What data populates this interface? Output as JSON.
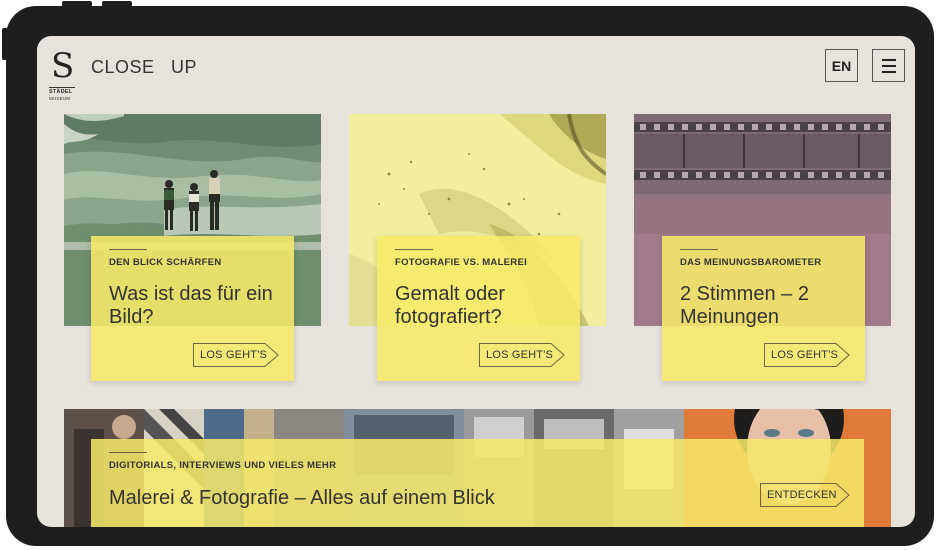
{
  "header": {
    "logo_mark": "S",
    "logo_line1": "STÄDEL",
    "logo_line2": "MUSEUM",
    "site_title": "CLOSE   UP",
    "lang_button": "EN"
  },
  "cards": [
    {
      "kicker": "DEN BLICK SCHÄRFEN",
      "title": "Was ist das für ein Bild?",
      "cta": "LOS GEHT'S"
    },
    {
      "kicker": "FOTOGRAFIE VS. MALEREI",
      "title": "Gemalt oder fotografiert?",
      "cta": "LOS GEHT'S"
    },
    {
      "kicker": "DAS MEINUNGSBAROMETER",
      "title": "2 Stimmen – 2 Meinungen",
      "cta": "LOS GEHT'S"
    }
  ],
  "feature": {
    "kicker": "DIGITORIALS, INTERVIEWS UND VIELES MEHR",
    "title": "Malerei & Fotografie – Alles auf einem Blick",
    "cta": "ENTDECKEN"
  },
  "colors": {
    "screen_bg": "#e7e2dc",
    "panel_yellow": "#f6e969",
    "device_frame": "#1e1e1e"
  },
  "icons": [
    "hamburger-menu-icon",
    "arrow-tag-icon"
  ]
}
